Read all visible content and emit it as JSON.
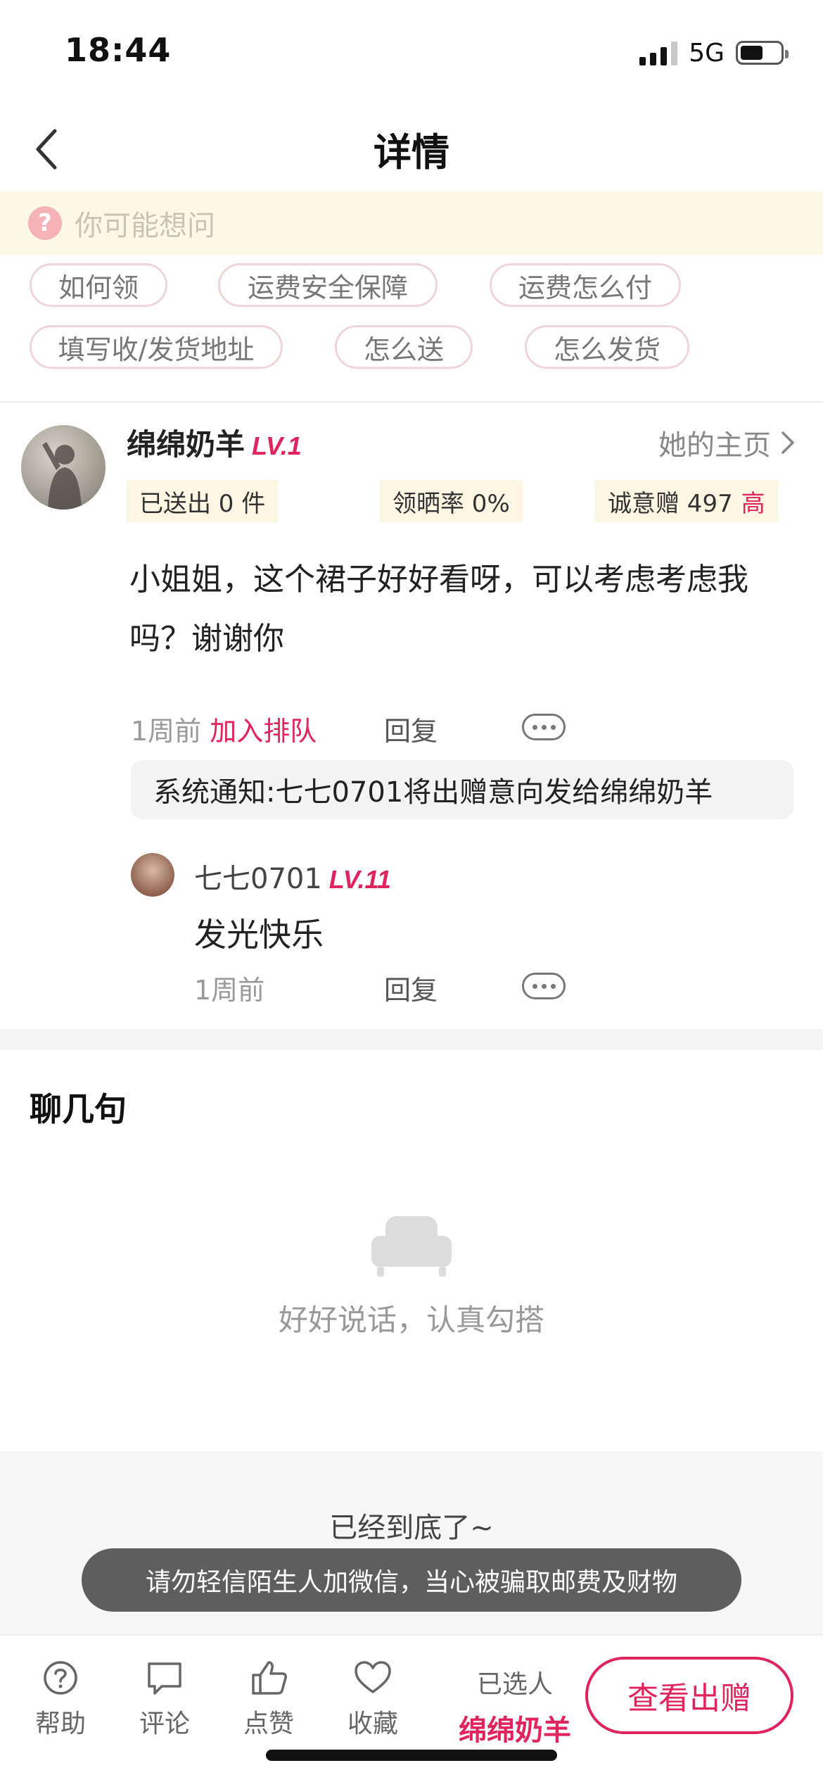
{
  "status_bar": {
    "time": "18:44",
    "network": "5G"
  },
  "nav": {
    "title": "详情"
  },
  "faq": {
    "prompt": "你可能想问",
    "chips": [
      "如何领",
      "运费安全保障",
      "运费怎么付",
      "填写收/发货地址",
      "怎么送",
      "怎么发货"
    ]
  },
  "post": {
    "username": "绵绵奶羊",
    "level": "LV.1",
    "home_link": "她的主页",
    "stats": {
      "sent": "已送出 0 件",
      "rate": "领晒率 0%",
      "sincerity": "诚意赠 497",
      "sincerity_tag": "高"
    },
    "content_line1": "小姐姐，这个裙子好好看呀，可以考虑考虑我",
    "content_line2": "吗？谢谢你",
    "time": "1周前",
    "join_queue": "加入排队",
    "reply": "回复",
    "notice": "系统通知:七七0701将出赠意向发给绵绵奶羊"
  },
  "comment": {
    "username": "七七0701",
    "level": "LV.11",
    "text": "发光快乐",
    "time": "1周前",
    "reply": "回复"
  },
  "chat": {
    "title": "聊几句",
    "empty_text": "好好说话，认真勾搭"
  },
  "footer": {
    "end_text": "已经到底了~",
    "toast": "请勿轻信陌生人加微信，当心被骗取邮费及财物"
  },
  "tabbar": {
    "help": "帮助",
    "comment": "评论",
    "like": "点赞",
    "favorite": "收藏",
    "selected_label": "已选人",
    "selected_name": "绵绵奶羊",
    "cta": "查看出赠"
  },
  "colors": {
    "accent": "#e0245e",
    "faq_bg": "#fdf8e6",
    "toast_bg": "#5e5e5e"
  }
}
